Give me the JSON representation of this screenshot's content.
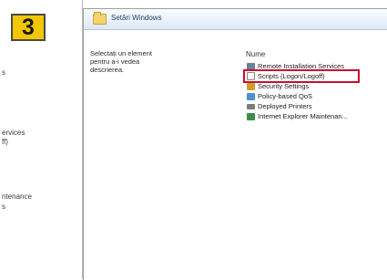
{
  "step_badge": "3",
  "left_pane": {
    "fragments": [
      "s",
      "ervices",
      "ff)",
      "ntenance",
      "s"
    ]
  },
  "header": {
    "title": "Setări Windows"
  },
  "description": "Selectați un element pentru a-i vedea descrierea.",
  "list": {
    "column_header": "Nume",
    "items": [
      {
        "label": "Remote Installation Services",
        "icon": "remote-installation-icon",
        "selected": false
      },
      {
        "label": "Scripts (Logon/Logoff)",
        "icon": "script-document-icon",
        "selected": true
      },
      {
        "label": "Security Settings",
        "icon": "security-settings-icon",
        "selected": false
      },
      {
        "label": "Policy-based QoS",
        "icon": "qos-chart-icon",
        "selected": false
      },
      {
        "label": "Deployed Printers",
        "icon": "printer-icon",
        "selected": false
      },
      {
        "label": "Internet Explorer Maintenan...",
        "icon": "internet-explorer-icon",
        "selected": false
      }
    ]
  },
  "colors": {
    "badge": "#f2c700",
    "selection_outline": "#c8102e"
  }
}
